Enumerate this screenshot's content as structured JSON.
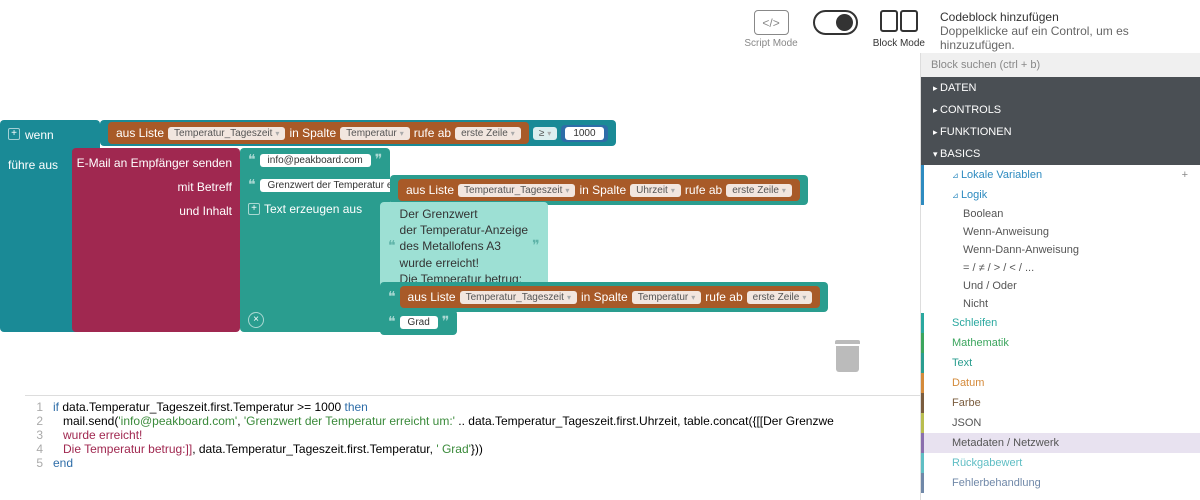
{
  "topbar": {
    "scriptMode": "Script Mode",
    "blockMode": "Block Mode",
    "helpTitle": "Codeblock hinzufügen",
    "helpSub": "Doppelklicke auf ein Control, um es hinzuzufügen."
  },
  "sidebar": {
    "searchPlaceholder": "Block suchen (ctrl + b)",
    "cats": {
      "daten": "DATEN",
      "controls": "CONTROLS",
      "funktionen": "FUNKTIONEN",
      "basics": "BASICS"
    },
    "items": {
      "lokaleVar": "Lokale Variablen",
      "logik": "Logik",
      "boolean": "Boolean",
      "wenn": "Wenn-Anweisung",
      "wennDann": "Wenn-Dann-Anweisung",
      "ops": "= / ≠ / > / < / ...",
      "undOder": "Und / Oder",
      "nicht": "Nicht",
      "schleifen": "Schleifen",
      "mathematik": "Mathematik",
      "text": "Text",
      "datum": "Datum",
      "farbe": "Farbe",
      "json": "JSON",
      "metadaten": "Metadaten / Netzwerk",
      "rueckgabe": "Rückgabewert",
      "fehler": "Fehlerbehandlung"
    }
  },
  "blocks": {
    "wenn": "wenn",
    "fuehreAus": "führe aus",
    "ausListe": "aus Liste",
    "tempTag": "Temperatur_Tageszeit",
    "inSpalte": "in Spalte",
    "temperatur": "Temperatur",
    "uhrzeit": "Uhrzeit",
    "rufeAb": "rufe ab",
    "ersteZeile": "erste Zeile",
    "gte": "≥",
    "thousand": "1000",
    "emailSenden": "E-Mail an Empfänger senden",
    "mitBetreff": "mit Betreff",
    "undInhalt": "und Inhalt",
    "infoEmail": "info@peakboard.com",
    "grenzwertBetreff": "Grenzwert der Temperatur erreicht",
    "textErzeugen": "Text erzeugen aus",
    "grad": "Grad",
    "bodyL1": "Der Grenzwert",
    "bodyL2": "der Temperatur-Anzeige",
    "bodyL3": "des Metallofens A3",
    "bodyL4": "wurde erreicht!",
    "bodyL5": "Die Temperatur betrug:"
  },
  "code": {
    "l1a": "if ",
    "l1b": "data.Temperatur_Tageszeit.first.Temperatur >= 1000 ",
    "l1c": "then",
    "l2a": "   mail.send(",
    "l2b": "'info@peakboard.com'",
    "l2c": ", ",
    "l2d": "'Grenzwert der Temperatur erreicht um:'",
    "l2e": " .. data.Temperatur_Tageszeit.first.Uhrzeit, table.concat({[[Der Grenzwe",
    "l3": "   wurde erreicht!",
    "l4a": "   Die Temperatur betrug:]]",
    "l4b": ", data.Temperatur_Tageszeit.first.Temperatur, ",
    "l4c": "' Grad'",
    "l4d": "}))",
    "l5": "end"
  }
}
